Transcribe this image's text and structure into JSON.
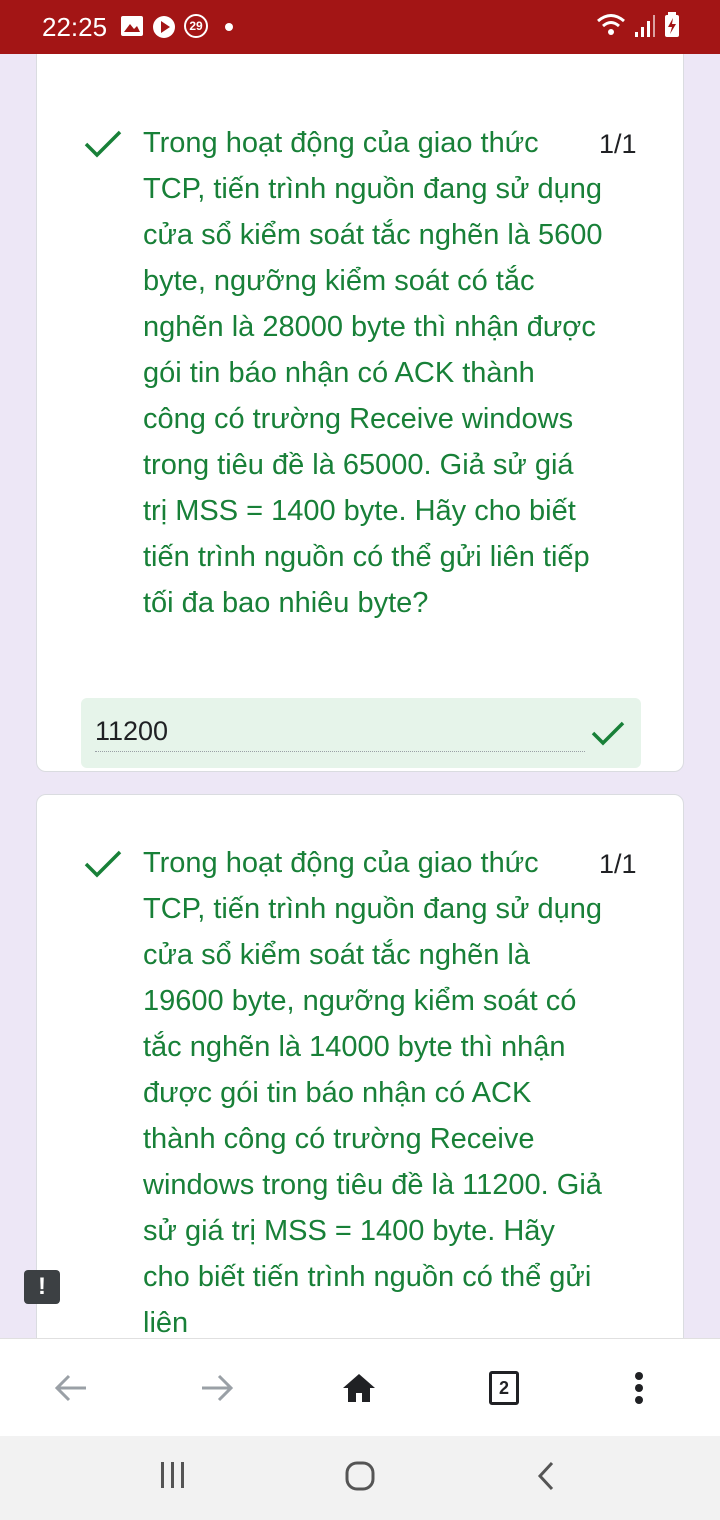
{
  "status_bar": {
    "time": "22:25",
    "badge_count": "29",
    "icons": [
      "image-icon",
      "play-icon",
      "notification-count-icon",
      "dot-icon",
      "wifi-icon",
      "signal-icon",
      "battery-charging-icon"
    ],
    "bar_color": "#a31515"
  },
  "questions": [
    {
      "text": "Trong hoạt động của giao thức TCP, tiến trình nguồn đang sử dụng cửa sổ kiểm soát tắc nghẽn là 5600 byte, ngưỡng kiểm soát có tắc nghẽn là 28000 byte thì nhận được gói tin báo nhận có ACK thành công có trường Receive windows trong tiêu đề là 65000. Giả sử giá trị MSS = 1400 byte. Hãy cho biết tiến trình nguồn có thể gửi liên tiếp tối đa bao nhiêu byte?",
      "score": "1/1",
      "answer": "11200",
      "correct": true
    },
    {
      "text": "Trong hoạt động của giao thức TCP, tiến trình nguồn đang sử dụng cửa sổ kiểm soát tắc nghẽn là 19600 byte, ngưỡng kiểm soát có tắc nghẽn là 14000 byte thì nhận được gói tin báo nhận có ACK thành công có trường Receive windows trong tiêu đề là 11200. Giả sử giá trị MSS = 1400 byte. Hãy cho biết tiến trình nguồn có thể gửi liên",
      "score": "1/1",
      "correct": true
    }
  ],
  "feedback_label": "!",
  "browser_toolbar": {
    "tab_count": "2",
    "buttons": [
      "back-arrow-icon",
      "forward-arrow-icon",
      "home-icon",
      "tabs-icon",
      "more-menu-icon"
    ]
  },
  "colors": {
    "correct_green": "#188038",
    "answer_bg": "#e6f4ea",
    "page_bg": "#ede7f6"
  }
}
